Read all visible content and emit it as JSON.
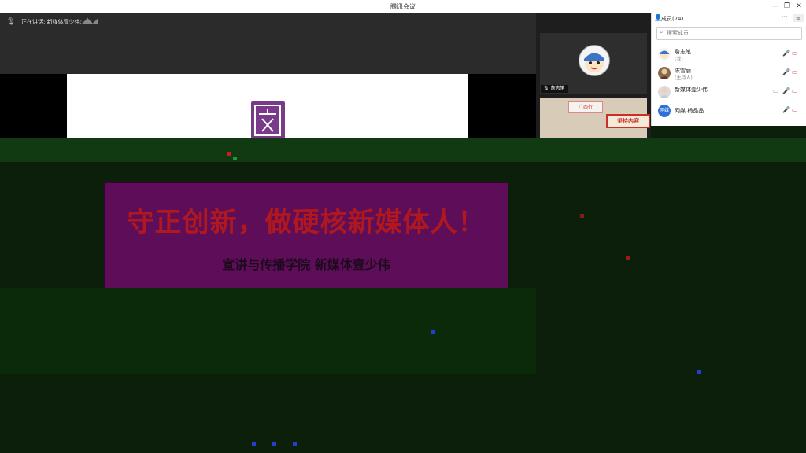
{
  "window": {
    "title": "腾讯会议",
    "controls": [
      "minimize",
      "restore",
      "close"
    ]
  },
  "speaker": {
    "label": "正在讲话: 新媒体壹少伟;"
  },
  "video": {
    "tile1_name": "詹志笔",
    "tile2_sign": "坚持内容",
    "tile2_sticker": "广西行"
  },
  "members_panel": {
    "title": "成员(74)",
    "more_label": "···",
    "search_placeholder": "搜索成员",
    "members": [
      {
        "name": "詹志笔",
        "sub": "(我)",
        "mic": "muted",
        "cam": "off"
      },
      {
        "name": "陈雪丽",
        "sub": "(主持人)",
        "mic": "muted",
        "cam": "off"
      },
      {
        "name": "新媒体壹少伟",
        "sub": "",
        "mic": "active",
        "cam": "off"
      },
      {
        "name": "网媒 杨晶晶",
        "sub": "",
        "mic": "muted",
        "cam": "off",
        "avatar_text": "网媒",
        "avatar_color": "#2f6fd6"
      }
    ]
  },
  "slide": {
    "headline": "守正创新，做硬核新媒体人！",
    "subline": "宣讲与传播学院 新媒体壹少伟"
  },
  "colors": {
    "accent": "#2f6fd6",
    "slide_bg": "#5e0e59",
    "headline": "#b0181e",
    "mic_active": "#2fbf4f",
    "muted_red": "#e0534f"
  }
}
